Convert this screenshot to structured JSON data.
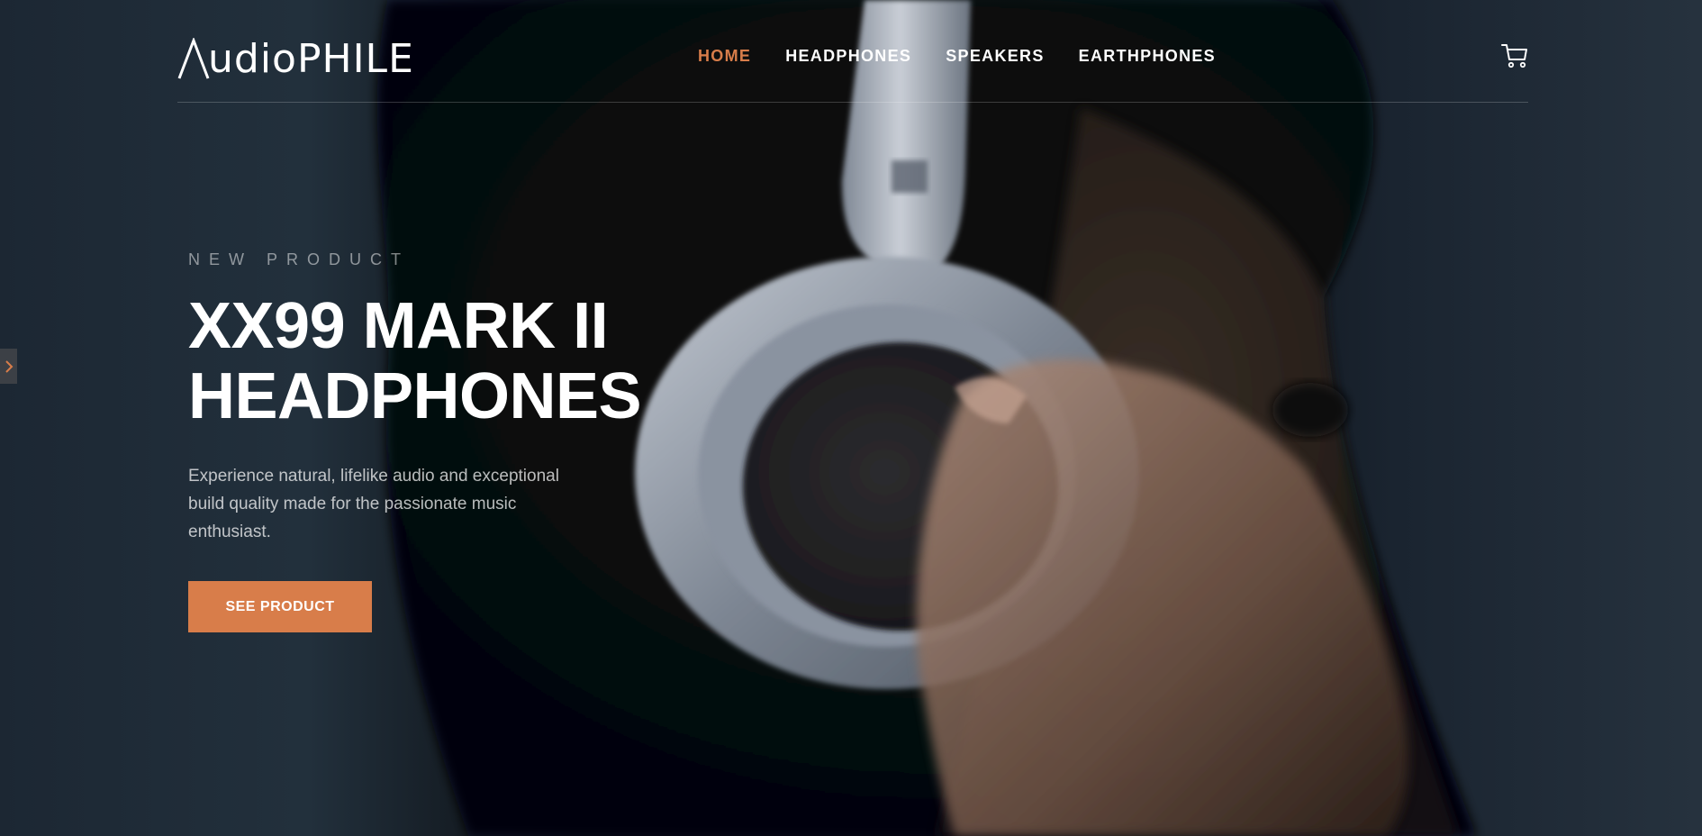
{
  "brand": {
    "logo_text": "udioPHILE",
    "logo_icon": "logo-a-mark-icon"
  },
  "nav": {
    "items": [
      {
        "label": "HOME",
        "active": true
      },
      {
        "label": "HEADPHONES",
        "active": false
      },
      {
        "label": "SPEAKERS",
        "active": false
      },
      {
        "label": "EARTHPHONES",
        "active": false
      }
    ],
    "cart_icon": "cart-icon"
  },
  "side_tab": {
    "icon": "chevron-right-icon"
  },
  "hero": {
    "overline": "NEW PRODUCT",
    "title_line1": "XX99 MARK II",
    "title_line2": "HEADPHONES",
    "description": "Experience natural, lifelike audio and exceptional build quality made for the passionate music enthusiast.",
    "cta_label": "SEE PRODUCT",
    "background_image": "person-wearing-headphones-photo"
  },
  "colors": {
    "accent": "#d87d4a",
    "text": "#ffffff",
    "background": "#0b0d10",
    "side_tab": "#3c4046"
  }
}
